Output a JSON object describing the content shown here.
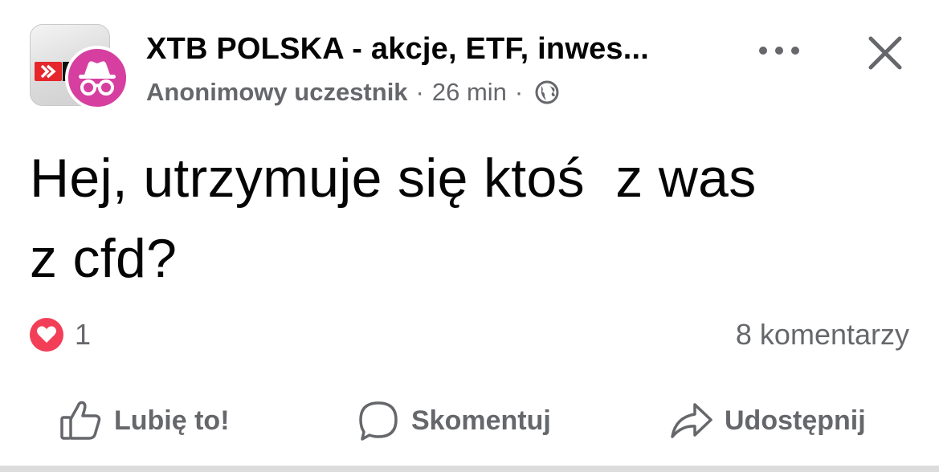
{
  "post": {
    "group_name": "XTB POLSKA - akcje, ETF, inwes...",
    "author": "Anonimowy uczestnik",
    "separator": "·",
    "time": "26 min",
    "privacy_icon": "globe-icon",
    "group_thumbnail_icon": "xtb-logo",
    "avatar_icon": "incognito-icon",
    "more_icon": "more-dots-icon",
    "close_icon": "close-icon",
    "text": "Hej, utrzymuje się ktoś  z was\nz cfd?",
    "reactions": {
      "icon": "heart-icon",
      "count": "1",
      "color": "#f33e58"
    },
    "comments_label": "8 komentarzy",
    "actions": [
      {
        "label": "Lubię to!",
        "icon": "thumbs-up-icon"
      },
      {
        "label": "Skomentuj",
        "icon": "comment-bubble-icon"
      },
      {
        "label": "Udostępnij",
        "icon": "share-arrow-icon"
      }
    ]
  },
  "colors": {
    "text_primary": "#050505",
    "text_secondary": "#65676b",
    "avatar_bg": "#d63fa0",
    "xtb_red": "#e5262b"
  }
}
